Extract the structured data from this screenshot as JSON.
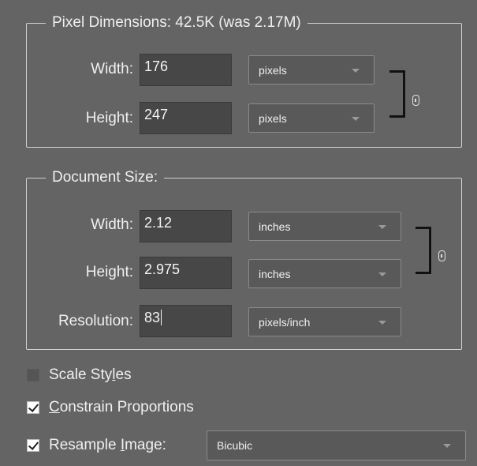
{
  "pixel_dimensions": {
    "legend": "Pixel Dimensions:  42.5K (was 2.17M)",
    "width_label": "Width:",
    "width_value": "176",
    "width_unit": "pixels",
    "height_label": "Height:",
    "height_value": "247",
    "height_unit": "pixels"
  },
  "document_size": {
    "legend": "Document Size:",
    "width_label": "Width:",
    "width_value": "2.12",
    "width_unit": "inches",
    "height_label": "Height:",
    "height_value": "2.975",
    "height_unit": "inches",
    "resolution_label": "Resolution:",
    "resolution_value": "83",
    "resolution_unit": "pixels/inch"
  },
  "options": {
    "scale_styles": {
      "pre": "Scale Sty",
      "u": "l",
      "post": "es",
      "checked": false
    },
    "constrain": {
      "pre": "",
      "u": "C",
      "post": "onstrain Proportions",
      "checked": true
    },
    "resample": {
      "pre": "Resample ",
      "u": "I",
      "post": "mage:",
      "checked": true
    },
    "resample_method": "Bicubic"
  },
  "icons": {
    "link": "chain-link-icon",
    "dropdown": "chevron-down-icon",
    "check": "checkmark-icon"
  },
  "colors": {
    "background": "#646464",
    "field": "#474747",
    "select": "#595959",
    "border": "#d0d0d0"
  }
}
